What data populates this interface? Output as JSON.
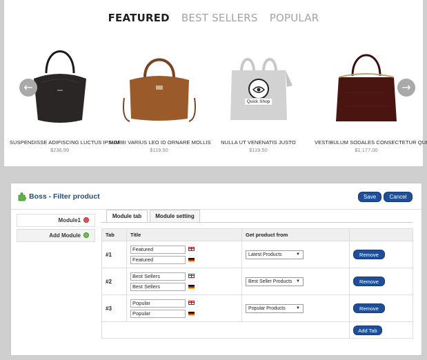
{
  "store": {
    "tabs": [
      {
        "label": "FEATURED",
        "active": true
      },
      {
        "label": "BEST SELLERS",
        "active": false
      },
      {
        "label": "POPULAR",
        "active": false
      }
    ],
    "products": [
      {
        "name": "SUSPENDISSE ADIPISCING LUCTUS IPSUM",
        "price": "$236.99",
        "color": "#2b2626"
      },
      {
        "name": "MORBI VARIUS LEO ID ORNARE MOLLIS",
        "price": "$119.50",
        "color": "#9a5a2a"
      },
      {
        "name": "NULLA UT VENENATIS JUSTO",
        "price": "$119.50",
        "color": "#c7c7c7"
      },
      {
        "name": "VESTIBULUM SODALES CONSECTETUR QUIS",
        "price": "$1,177.00",
        "color": "#4a1410"
      }
    ],
    "quick_shop_label": "Quick Shop",
    "prev_icon": "arrow-left-icon",
    "next_icon": "arrow-right-icon"
  },
  "admin": {
    "title": "Boss - Filter product",
    "save_label": "Save",
    "cancel_label": "Cancel",
    "sidebar": {
      "items": [
        {
          "label": "Module1"
        },
        {
          "label": "Add Module"
        }
      ]
    },
    "tabs": [
      {
        "label": "Module tab"
      },
      {
        "label": "Module setting"
      }
    ],
    "table": {
      "headers": [
        "Tab",
        "Title",
        "Get product from",
        ""
      ],
      "rows": [
        {
          "tab": "#1",
          "title_en": "Featured",
          "title_de": "Featured",
          "source": "Latest Products",
          "remove": "Remove"
        },
        {
          "tab": "#2",
          "title_en": "Best Sellers",
          "title_de": "Best Sellers",
          "source": "Best Seller Products",
          "remove": "Remove"
        },
        {
          "tab": "#3",
          "title_en": "Popular",
          "title_de": "Popular",
          "source": "Popular Products",
          "remove": "Remove"
        }
      ],
      "add_tab_label": "Add Tab"
    },
    "accent_color": "#1f4f99"
  }
}
